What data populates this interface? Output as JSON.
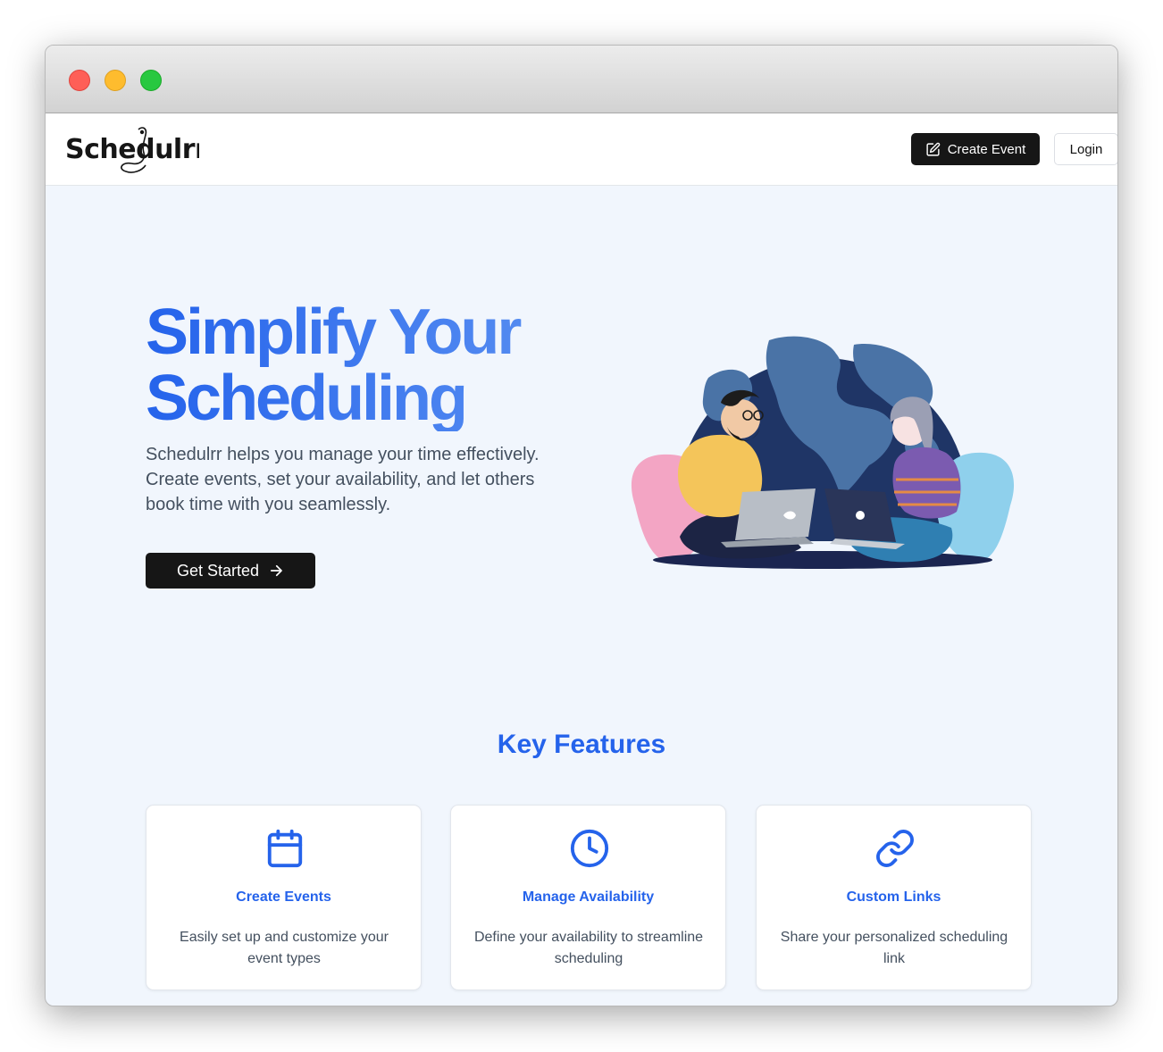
{
  "app": {
    "logo_text": "Schedulrr"
  },
  "navbar": {
    "create_event_label": "Create Event",
    "login_label": "Login"
  },
  "hero": {
    "title_line1": "Simplify Your",
    "title_line2": "Scheduling",
    "description": "Schedulrr helps you manage your time effectively. Create events, set your availability, and let others book time with you seamlessly.",
    "cta_label": "Get Started"
  },
  "features": {
    "heading": "Key Features",
    "items": [
      {
        "icon": "calendar-icon",
        "title": "Create Events",
        "description": "Easily set up and customize your event types"
      },
      {
        "icon": "clock-icon",
        "title": "Manage Availability",
        "description": "Define your availability to streamline scheduling"
      },
      {
        "icon": "link-icon",
        "title": "Custom Links",
        "description": "Share your personalized scheduling link"
      }
    ]
  },
  "colors": {
    "accent": "#2563eb",
    "button_dark": "#161616",
    "page_bg": "#f1f6fd"
  }
}
